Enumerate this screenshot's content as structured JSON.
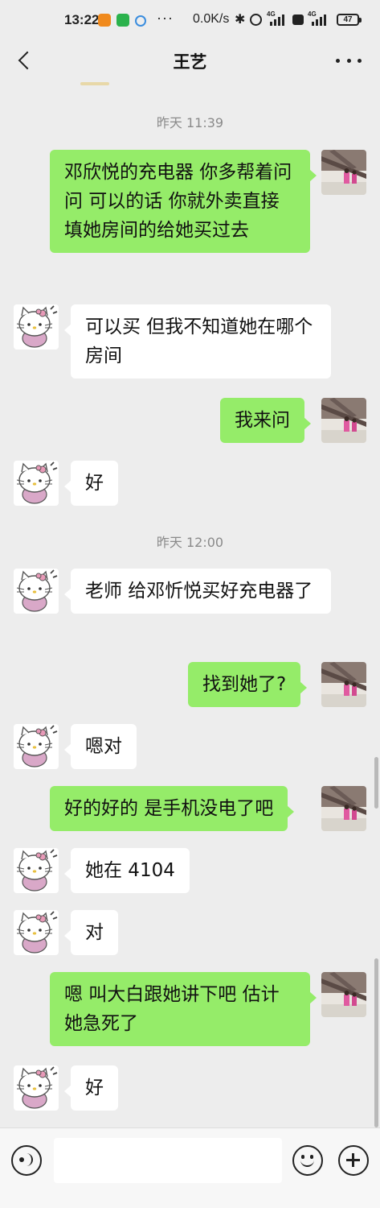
{
  "status_bar": {
    "time": "13:22",
    "dots": "···",
    "net_speed": "0.0K/s",
    "bluetooth_glyph": "✱",
    "net_type_1": "4G",
    "net_type_2": "4G",
    "battery": "47"
  },
  "header": {
    "title": "王艺"
  },
  "icons": {
    "back": "chevron-left-icon",
    "more": "more-dots-icon",
    "voice": "voice-icon",
    "emoji": "emoji-icon",
    "plus": "plus-icon"
  },
  "colors": {
    "outgoing_bubble": "#95ec69",
    "incoming_bubble": "#ffffff",
    "chat_background": "#ededed"
  },
  "chat": {
    "timestamps": [
      "昨天 11:39",
      "昨天 12:00"
    ],
    "messages": [
      {
        "from": "me",
        "text": "邓欣悦的充电器 你多帮着问问 可以的话 你就外卖直接填她房间的给她买过去"
      },
      {
        "from": "other",
        "text": "可以买 但我不知道她在哪个房间"
      },
      {
        "from": "me",
        "text": "我来问"
      },
      {
        "from": "other",
        "text": "好"
      },
      {
        "from": "other",
        "text": "老师 给邓忻悦买好充电器了"
      },
      {
        "from": "me",
        "text": "找到她了?"
      },
      {
        "from": "other",
        "text": "嗯对"
      },
      {
        "from": "me",
        "text": "好的好的 是手机没电了吧"
      },
      {
        "from": "other",
        "text": "她在 4104"
      },
      {
        "from": "other",
        "text": "对"
      },
      {
        "from": "me",
        "text": "嗯 叫大白跟她讲下吧 估计她急死了"
      },
      {
        "from": "other",
        "text": "好"
      }
    ]
  },
  "input": {
    "value": "",
    "placeholder": ""
  }
}
